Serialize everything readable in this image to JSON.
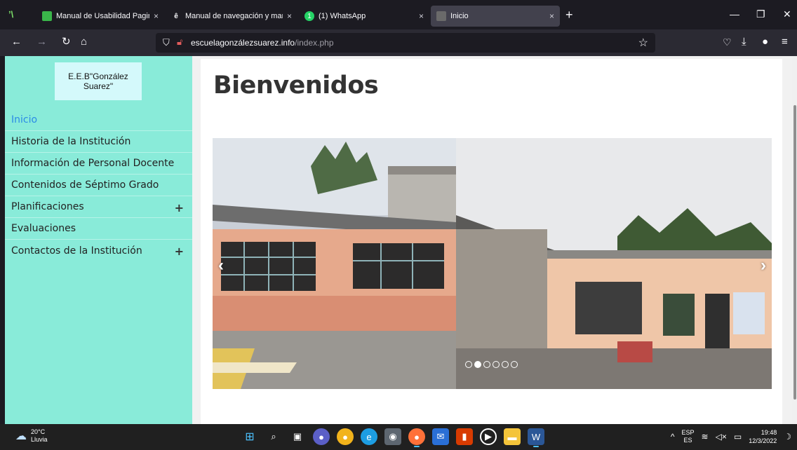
{
  "browser": {
    "tabs": [
      {
        "title": "Manual de Usabilidad Pagina W",
        "favicon_color": "#3ab54a",
        "active": false
      },
      {
        "title": "Manual de navegación y manej",
        "favicon_color": "#444",
        "active": false
      },
      {
        "title": "(1) WhatsApp",
        "favicon_color": "#25d366",
        "favicon_text": "1",
        "active": false
      },
      {
        "title": "Inicio",
        "favicon_color": "#6a6a6a",
        "active": true
      }
    ],
    "new_tab_label": "+",
    "url_host": "escuelagonzálezsuarez.info",
    "url_path": "/index.php"
  },
  "site": {
    "logo_text": "E.E.B\"González Suarez\"",
    "menu": [
      {
        "label": "Inicio",
        "active": true,
        "expandable": false
      },
      {
        "label": "Historia de la Institución",
        "active": false,
        "expandable": false
      },
      {
        "label": "Información de Personal Docente",
        "active": false,
        "expandable": false
      },
      {
        "label": "Contenidos de Séptimo Grado",
        "active": false,
        "expandable": false
      },
      {
        "label": "Planificaciones",
        "active": false,
        "expandable": true
      },
      {
        "label": "Evaluaciones",
        "active": false,
        "expandable": false
      },
      {
        "label": "Contactos de la Institución",
        "active": false,
        "expandable": true
      }
    ],
    "heading": "Bienvenidos",
    "carousel": {
      "slide_count": 6,
      "active_index": 1
    }
  },
  "taskbar": {
    "weather_temp": "20°C",
    "weather_desc": "Lluvia",
    "lang_top": "ESP",
    "lang_bottom": "ES",
    "time": "19:48",
    "date": "12/3/2022"
  },
  "colors": {
    "sidebar_bg": "#89ebd9",
    "menu_active": "#2b8be6",
    "logo_bg": "#d4f9fb"
  }
}
